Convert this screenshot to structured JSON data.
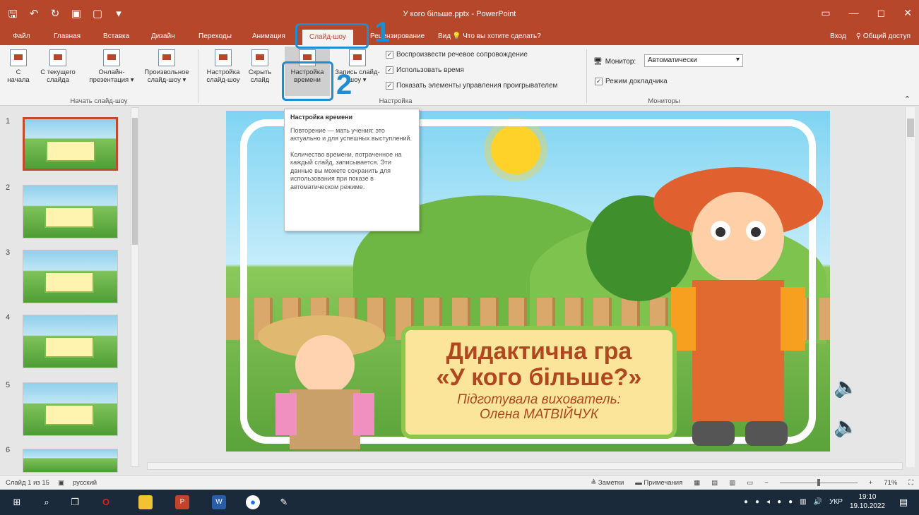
{
  "window": {
    "title": "У кого більше.pptx - PowerPoint",
    "controls": [
      "▭",
      "—",
      "◻",
      "✕"
    ]
  },
  "qat": [
    "🖫",
    "↶",
    "↻",
    "▣",
    "▢",
    "▾"
  ],
  "tabs": [
    {
      "label": "Файл"
    },
    {
      "label": "Главная"
    },
    {
      "label": "Вставка"
    },
    {
      "label": "Дизайн"
    },
    {
      "label": "Переходы"
    },
    {
      "label": "Анимация"
    },
    {
      "label": "Слайд-шоу",
      "active": true
    },
    {
      "label": "Рецензирование"
    },
    {
      "label": "Вид"
    }
  ],
  "tell_me": "Что вы хотите сделать?",
  "account": {
    "signin": "Вход",
    "share": "Общий доступ"
  },
  "ribbon": {
    "start_group": {
      "label": "Начать слайд-шоу",
      "buttons": [
        {
          "label1": "С",
          "label2": "начала"
        },
        {
          "label1": "С текущего",
          "label2": "слайда"
        },
        {
          "label1": "Онлайн-",
          "label2": "презентация ▾"
        },
        {
          "label1": "Произвольное",
          "label2": "слайд-шоу ▾"
        }
      ]
    },
    "setup_group": {
      "label": "Настройка",
      "buttons": [
        {
          "label1": "Настройка",
          "label2": "слайд-шоу"
        },
        {
          "label1": "Скрыть",
          "label2": "слайд"
        },
        {
          "label1": "Настройка",
          "label2": "времени"
        },
        {
          "label1": "Запись слайд-",
          "label2": "шоу ▾"
        }
      ],
      "checks": [
        "Воспроизвести речевое сопровождение",
        "Использовать время",
        "Показать элементы управления проигрывателем"
      ]
    },
    "monitors_group": {
      "label": "Мониторы",
      "monitor_label": "Монитор:",
      "monitor_value": "Автоматически",
      "presenter_view": "Режим докладчика"
    }
  },
  "callouts": {
    "n1": "1",
    "n2": "2"
  },
  "tooltip": {
    "title": "Настройка времени",
    "p1": "Повторение — мать учения: это актуально и для успешных выступлений.",
    "p2": "Количество времени, потраченное на каждый слайд, записывается. Эти данные вы можете сохранить для использования при показе в автоматическом режиме."
  },
  "thumbnails": [
    {
      "num": "1",
      "selected": true
    },
    {
      "num": "2"
    },
    {
      "num": "3"
    },
    {
      "num": "4"
    },
    {
      "num": "5"
    },
    {
      "num": "6"
    }
  ],
  "slide": {
    "title1": "Дидактична гра",
    "title2": "«У кого більше?»",
    "subtitle1": "Підготувала вихователь:",
    "subtitle2": "Олена МАТВІЙЧУК"
  },
  "status": {
    "slide_info": "Слайд 1 из 15",
    "language": "русский",
    "notes": "Заметки",
    "comments": "Примечания",
    "zoom": "71%",
    "zoom_level": 0.5
  },
  "taskbar": {
    "lang": "УКР",
    "time": "19:10",
    "date": "19.10.2022"
  }
}
